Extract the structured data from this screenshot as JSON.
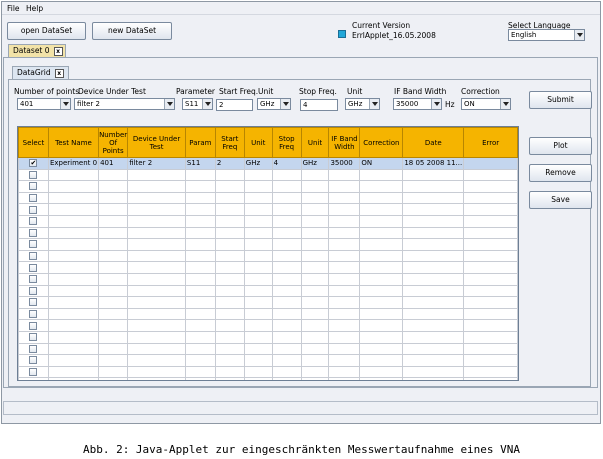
{
  "menu": {
    "file": "File",
    "help": "Help"
  },
  "toolbar": {
    "open_dataset": "open DataSet",
    "new_dataset": "new DataSet"
  },
  "version": {
    "label": "Current Version",
    "value": "ErrlApplet_16.05.2008"
  },
  "language": {
    "label": "Select Language",
    "value": "English"
  },
  "tabs": {
    "dataset": "Dataset 0",
    "datagrid": "DataGrid",
    "close": "x"
  },
  "form": {
    "num_points": {
      "label": "Number of points",
      "value": "401"
    },
    "device": {
      "label": "Device Under Test",
      "value": "filter 2"
    },
    "parameter": {
      "label": "Parameter",
      "value": "S11"
    },
    "start_freq": {
      "label": "Start Freq.",
      "value": "2"
    },
    "start_unit": {
      "label": "Unit",
      "value": "GHz"
    },
    "stop_freq": {
      "label": "Stop Freq.",
      "value": "4"
    },
    "stop_unit": {
      "label": "Unit",
      "value": "GHz"
    },
    "if_bw": {
      "label": "IF Band Width",
      "value": "35000",
      "unit": "Hz"
    },
    "correction": {
      "label": "Correction",
      "value": "ON"
    }
  },
  "buttons": {
    "submit": "Submit",
    "plot": "Plot",
    "remove": "Remove",
    "save": "Save"
  },
  "table": {
    "columns": [
      "Select",
      "Test Name",
      "Number Of Points",
      "Device Under Test",
      "Param",
      "Start Freq",
      "Unit",
      "Stop Freq",
      "Unit",
      "IF Band Width",
      "Correction",
      "Date",
      "Error"
    ],
    "rows": [
      [
        "✔",
        "Experiment 0",
        "401",
        "filter 2",
        "S11",
        "2",
        "GHz",
        "4",
        "GHz",
        "35000",
        "ON",
        "18 05 2008 11...",
        ""
      ]
    ],
    "empty_rows": 19
  },
  "caption": "Abb. 2: Java-Applet zur eingeschränkten Messwertaufnahme eines VNA"
}
